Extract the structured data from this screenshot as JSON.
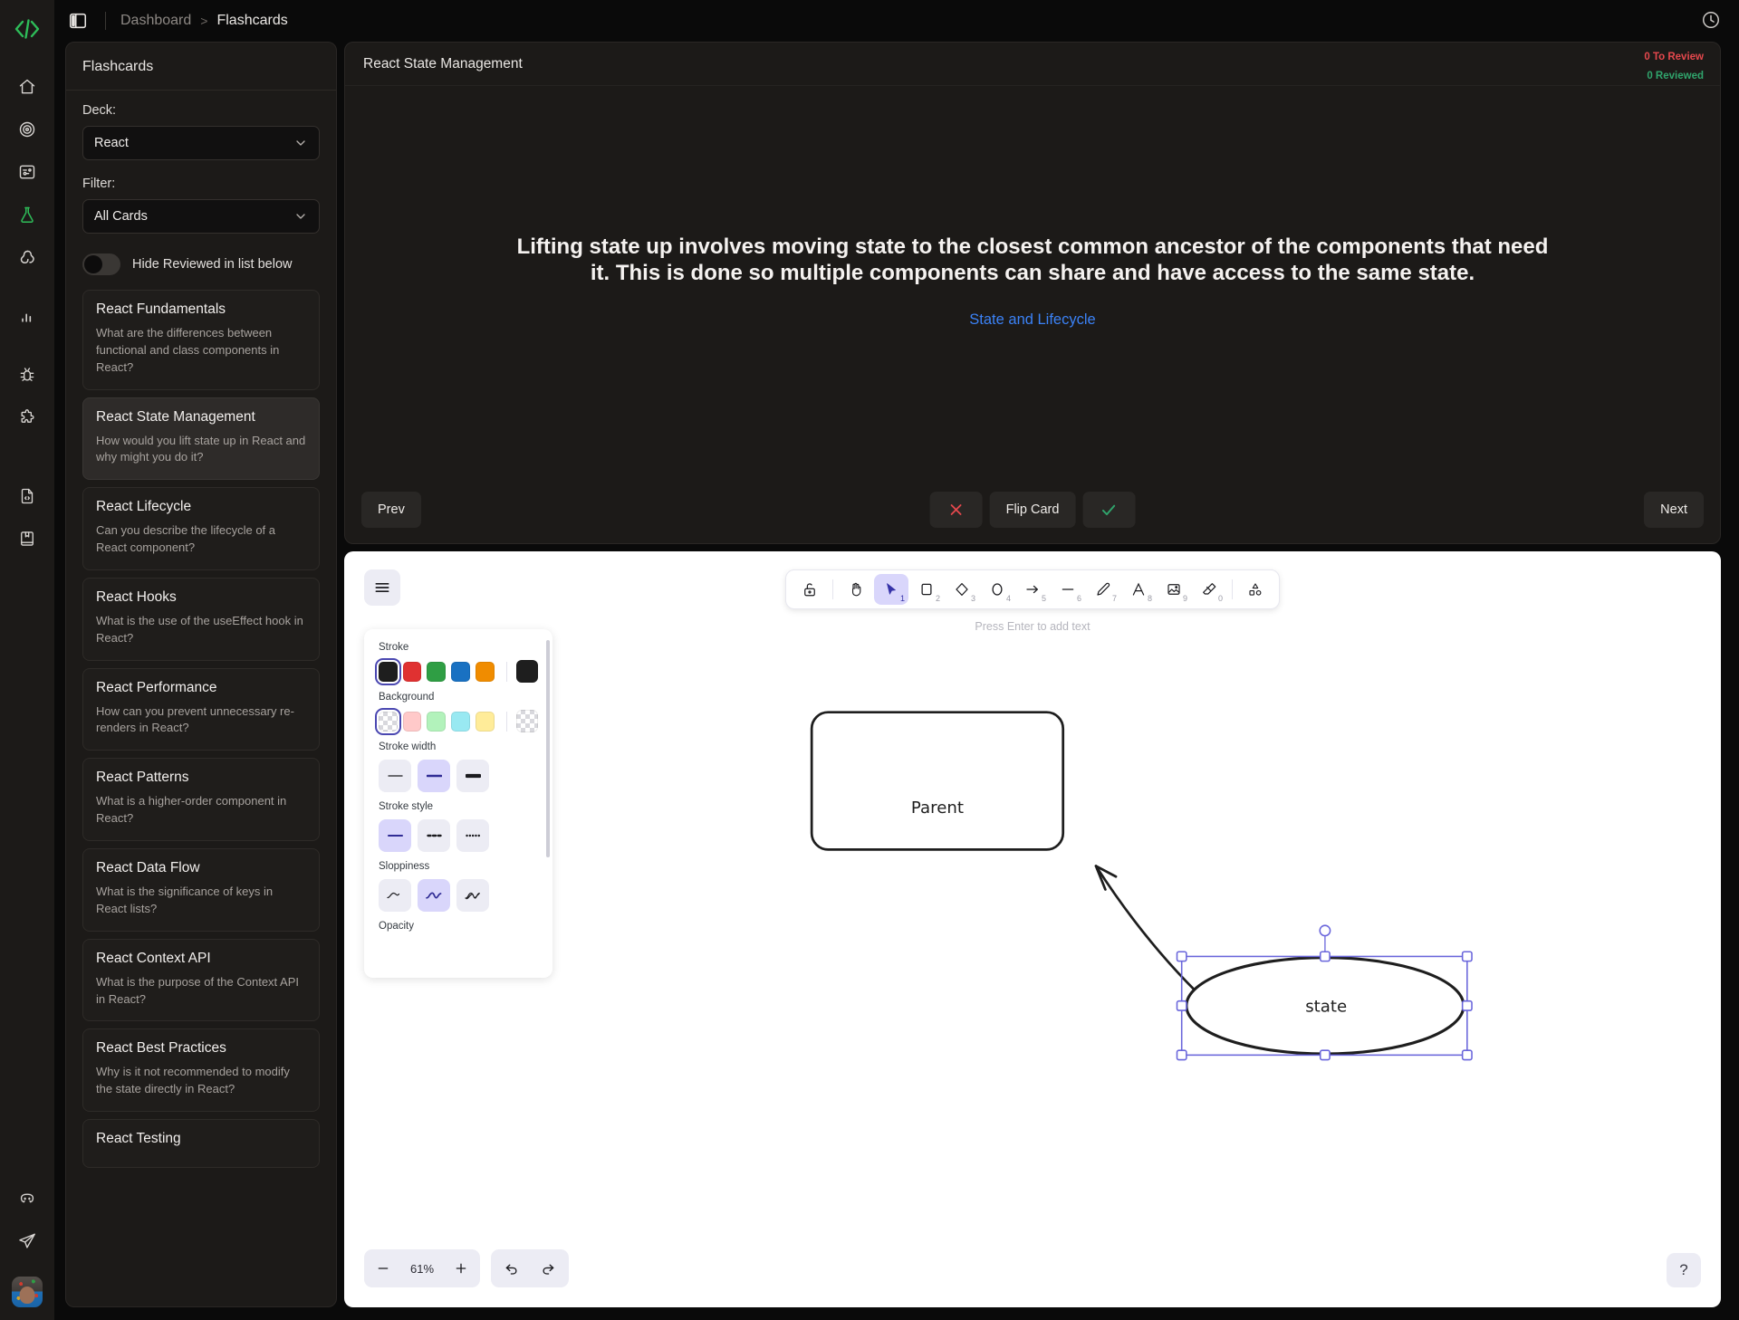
{
  "topbar": {
    "panel_toggle_icon": "panel-left-icon",
    "breadcrumb": {
      "root": "Dashboard",
      "separator": ">",
      "current": "Flashcards"
    },
    "history_icon": "clock-history-icon"
  },
  "rail": {
    "logo_icon": "code-brackets-logo",
    "items": [
      {
        "icon": "home-icon",
        "active": false
      },
      {
        "icon": "target-icon",
        "active": false
      },
      {
        "icon": "circuit-board-icon",
        "active": false
      },
      {
        "icon": "flask-icon",
        "active": true
      },
      {
        "icon": "node-graph-icon",
        "active": false
      },
      {
        "icon": "bar-chart-icon",
        "active": false
      },
      {
        "icon": "bug-icon",
        "active": false
      },
      {
        "icon": "puzzle-icon",
        "active": false
      },
      {
        "icon": "file-code-icon",
        "active": false
      },
      {
        "icon": "book-bookmark-icon",
        "active": false
      }
    ],
    "bottom_items": [
      {
        "icon": "discord-icon"
      },
      {
        "icon": "send-icon"
      }
    ],
    "avatar_icon": "user-avatar"
  },
  "flashcards": {
    "panel_title": "Flashcards",
    "deck_label": "Deck:",
    "deck_value": "React",
    "filter_label": "Filter:",
    "filter_value": "All Cards",
    "hide_reviewed_label": "Hide Reviewed in list below",
    "hide_reviewed_on": false,
    "cards": [
      {
        "title": "React Fundamentals",
        "question": "What are the differences between functional and class components in React?",
        "selected": false
      },
      {
        "title": "React State Management",
        "question": "How would you lift state up in React and why might you do it?",
        "selected": true
      },
      {
        "title": "React Lifecycle",
        "question": "Can you describe the lifecycle of a React component?",
        "selected": false
      },
      {
        "title": "React Hooks",
        "question": "What is the use of the useEffect hook in React?",
        "selected": false
      },
      {
        "title": "React Performance",
        "question": "How can you prevent unnecessary re-renders in React?",
        "selected": false
      },
      {
        "title": "React Patterns",
        "question": "What is a higher-order component in React?",
        "selected": false
      },
      {
        "title": "React Data Flow",
        "question": "What is the significance of keys in React lists?",
        "selected": false
      },
      {
        "title": "React Context API",
        "question": "What is the purpose of the Context API in React?",
        "selected": false
      },
      {
        "title": "React Best Practices",
        "question": "Why is it not recommended to modify the state directly in React?",
        "selected": false
      },
      {
        "title": "React Testing",
        "question": "",
        "selected": false
      }
    ]
  },
  "study": {
    "title": "React State Management",
    "to_review_badge": "0 To Review",
    "reviewed_badge": "0 Reviewed",
    "to_review_color": "#e5484d",
    "reviewed_color": "#30a46c",
    "answer": "Lifting state up involves moving state to the closest common ancestor of the components that need it. This is done so multiple components can share and have access to the same state.",
    "link_text": "State and Lifecycle",
    "link_color": "#3b82f6",
    "prev_label": "Prev",
    "mark_wrong_icon": "x-icon",
    "flip_label": "Flip Card",
    "mark_right_icon": "check-icon",
    "next_label": "Next"
  },
  "excalidraw": {
    "hamburger_icon": "hamburger-menu-icon",
    "hint": "Press Enter to add text",
    "tools": [
      {
        "icon": "lock-open-icon",
        "key": "",
        "active": false
      },
      {
        "icon": "hand-icon",
        "key": "",
        "active": false
      },
      {
        "icon": "selection-arrow-icon",
        "key": "1",
        "active": true
      },
      {
        "icon": "rectangle-icon",
        "key": "2",
        "active": false
      },
      {
        "icon": "diamond-icon",
        "key": "3",
        "active": false
      },
      {
        "icon": "ellipse-icon",
        "key": "4",
        "active": false
      },
      {
        "icon": "arrow-icon",
        "key": "5",
        "active": false
      },
      {
        "icon": "line-icon",
        "key": "6",
        "active": false
      },
      {
        "icon": "pencil-draw-icon",
        "key": "7",
        "active": false
      },
      {
        "icon": "text-icon",
        "key": "8",
        "active": false
      },
      {
        "icon": "image-icon",
        "key": "9",
        "active": false
      },
      {
        "icon": "eraser-icon",
        "key": "0",
        "active": false
      },
      {
        "icon": "shapes-library-icon",
        "key": "",
        "active": false
      }
    ],
    "props": {
      "stroke_label": "Stroke",
      "stroke_colors": [
        "#1e1e1e",
        "#e03131",
        "#2f9e44",
        "#1971c2",
        "#f08c00"
      ],
      "stroke_selected_index": 0,
      "stroke_current": "#1e1e1e",
      "background_label": "Background",
      "background_colors": [
        "transparent",
        "#ffc9c9",
        "#b2f2bb",
        "#99e9f2",
        "#ffec99"
      ],
      "background_selected_index": 0,
      "background_current": "transparent",
      "stroke_width_label": "Stroke width",
      "stroke_width_selected_index": 1,
      "stroke_style_label": "Stroke style",
      "stroke_style_selected_index": 0,
      "sloppiness_label": "Sloppiness",
      "sloppiness_selected_index": 1,
      "opacity_label": "Opacity"
    },
    "canvas": {
      "shapes": [
        {
          "type": "rectangle",
          "label": "Parent"
        },
        {
          "type": "ellipse",
          "label": "state",
          "selected": true
        },
        {
          "type": "arrow",
          "label": ""
        }
      ]
    },
    "zoom_out_icon": "minus-icon",
    "zoom_value": "61%",
    "zoom_in_icon": "plus-icon",
    "undo_icon": "undo-icon",
    "redo_icon": "redo-icon",
    "help_icon": "help-question-icon"
  }
}
